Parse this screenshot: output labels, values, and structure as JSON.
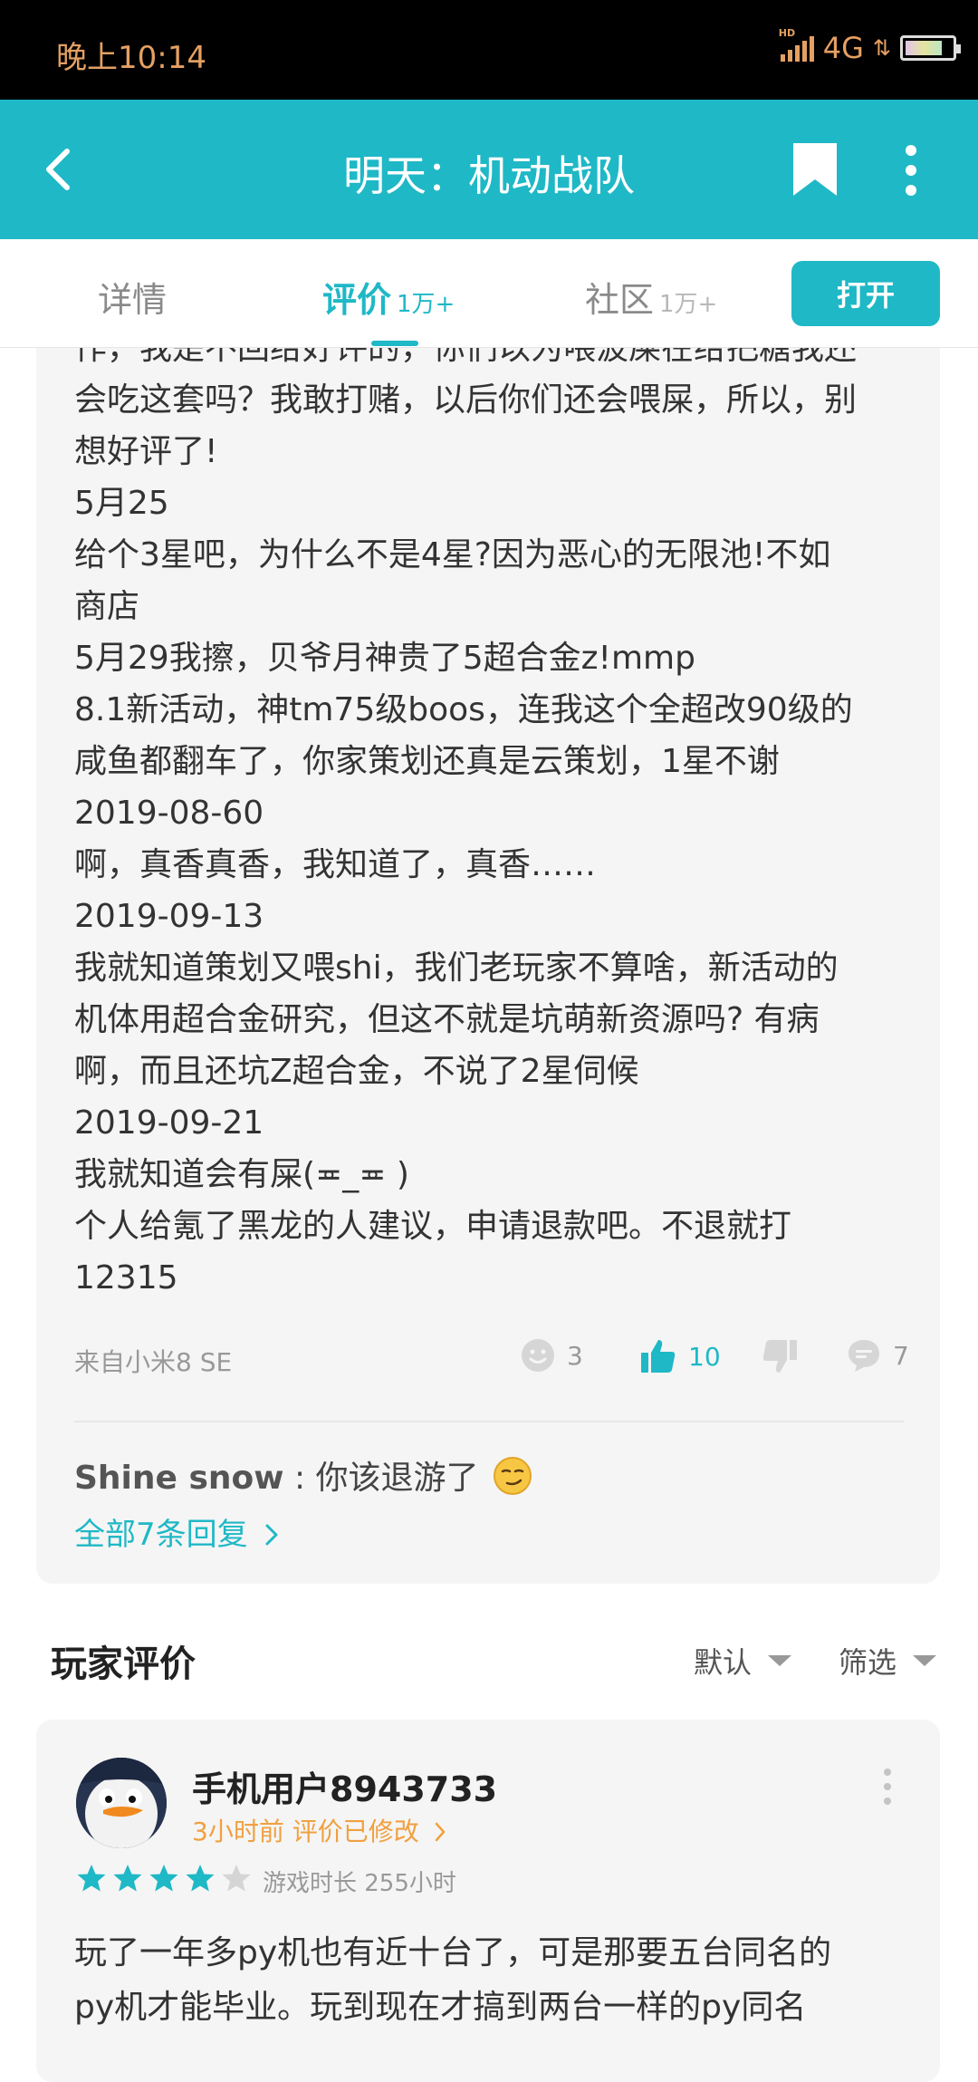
{
  "status_bar": {
    "time": "晚上10:14",
    "hd": "HD",
    "network": "4G",
    "arrows": "⇅"
  },
  "app_bar": {
    "title": "明天：机动战队"
  },
  "tabs": [
    {
      "label": "详情",
      "count": ""
    },
    {
      "label": "评价",
      "count": "1万+"
    },
    {
      "label": "社区",
      "count": "1万+"
    }
  ],
  "open_button": "打开",
  "review_top": {
    "lines": [
      "作，我是不回给好评的，你们以为喂波屎在给把糖我还",
      "会吃这套吗？我敢打赌，以后你们还会喂屎，所以，别",
      "想好评了!",
      "5月25",
      "给个3星吧，为什么不是4星?因为恶心的无限池!不如",
      "商店",
      "5月29我擦，贝爷月神贵了5超合金z!mmp",
      "8.1新活动，神tm75级boos，连我这个全超改90级的",
      "咸鱼都翻车了，你家策划还真是云策划，1星不谢",
      "2019-08-60",
      "啊，真香真香，我知道了，真香……",
      "2019-09-13",
      "我就知道策划又喂shi，我们老玩家不算啥，新活动的",
      "机体用超合金研究，但这不就是坑萌新资源吗? 有病",
      "啊，而且还坑Z超合金，不说了2星伺候",
      "2019-09-21",
      "我就知道会有屎(≖_≖ )",
      "个人给氪了黑龙的人建议，申请退款吧。不退就打",
      "12315"
    ],
    "device": "来自小米8 SE",
    "funny_count": "3",
    "like_count": "10",
    "reply_count": "7",
    "reply_user": "Shine snow",
    "reply_sep": " : ",
    "reply_text": "你该退游了",
    "all_replies": "全部7条回复"
  },
  "player_reviews": {
    "title": "玩家评价",
    "sort": "默认",
    "filter": "筛选"
  },
  "review_2": {
    "username": "手机用户8943733",
    "time_text": "3小时前 评价已修改",
    "rating": 4,
    "rating_max": 5,
    "playtime": "游戏时长 255小时",
    "lines": [
      "玩了一年多py机也有近十台了，可是那要五台同名的",
      "py机才能毕业。玩到现在才搞到两台一样的py同名"
    ]
  },
  "colors": {
    "accent": "#1fb8c6",
    "status_text": "#e4a062",
    "timeline": "#f0a040",
    "star_filled": "#1fb8c6",
    "star_empty": "#d5d5d5"
  }
}
